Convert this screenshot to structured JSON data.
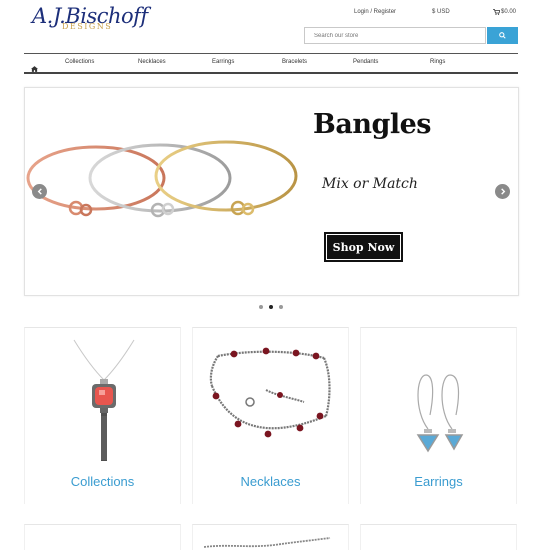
{
  "header": {
    "logo_text": "A.J.Bischoff",
    "logo_sub": "DESIGNS",
    "login_label": "Login / Register",
    "currency_label": "$ USD",
    "cart_total": "$0.00",
    "search_placeholder": "Search our store"
  },
  "nav": {
    "items": [
      "Collections",
      "Necklaces",
      "Earrings",
      "Bracelets",
      "Pendants",
      "Rings"
    ]
  },
  "slider": {
    "title": "Bangles",
    "subtitle": "Mix or Match",
    "button_label": "Shop Now",
    "slide_count": 3,
    "active_slide": 2
  },
  "categories": [
    {
      "label": "Collections"
    },
    {
      "label": "Necklaces"
    },
    {
      "label": "Earrings"
    }
  ],
  "colors": {
    "accent": "#3aa3d6",
    "link": "#3a9cd0",
    "logo_blue": "#1d2f7a",
    "logo_gold": "#c9a04a"
  }
}
